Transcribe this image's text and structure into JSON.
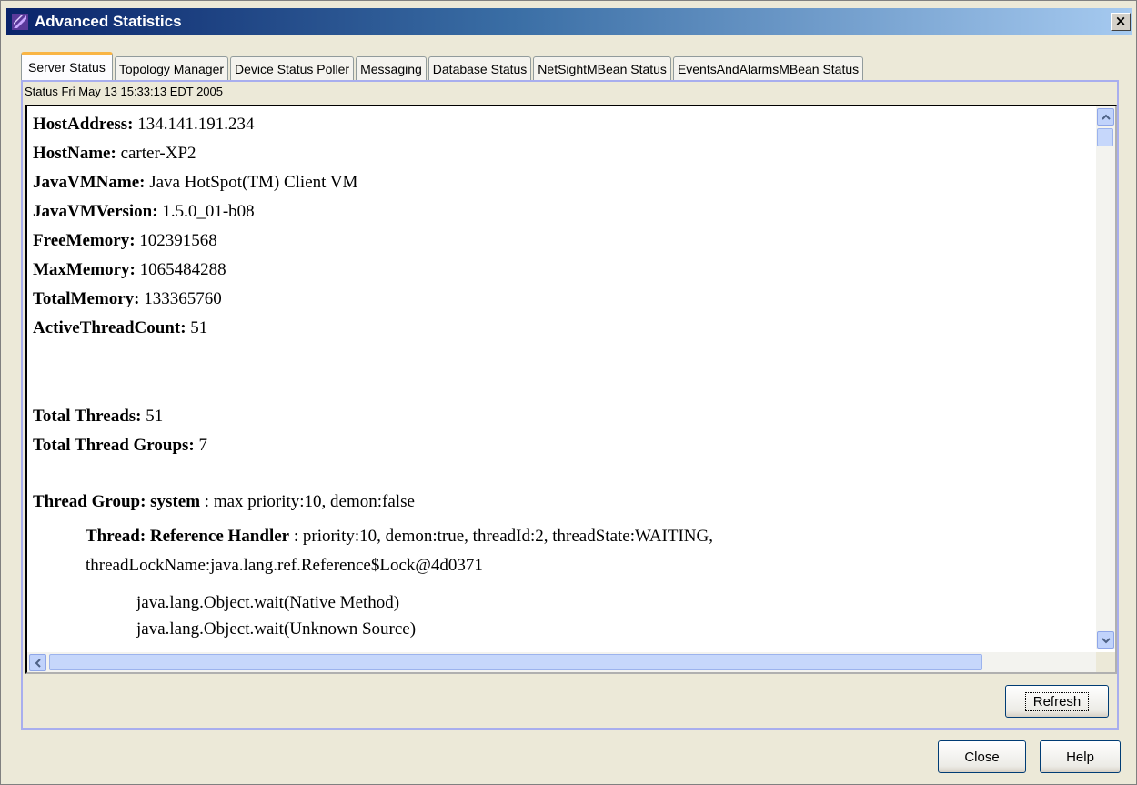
{
  "window": {
    "title": "Advanced Statistics",
    "close_glyph": "×"
  },
  "tabs": [
    {
      "label": "Server Status",
      "active": true
    },
    {
      "label": "Topology Manager",
      "active": false
    },
    {
      "label": "Device Status Poller",
      "active": false
    },
    {
      "label": "Messaging",
      "active": false
    },
    {
      "label": "Database Status",
      "active": false
    },
    {
      "label": "NetSightMBean Status",
      "active": false
    },
    {
      "label": "EventsAndAlarmsMBean Status",
      "active": false
    }
  ],
  "status": "Status Fri May 13 15:33:13 EDT 2005",
  "properties": [
    {
      "key": "HostAddress:",
      "value": " 134.141.191.234"
    },
    {
      "key": "HostName:",
      "value": " carter-XP2"
    },
    {
      "key": "JavaVMName:",
      "value": " Java HotSpot(TM) Client VM"
    },
    {
      "key": "JavaVMVersion:",
      "value": " 1.5.0_01-b08"
    },
    {
      "key": "FreeMemory:",
      "value": " 102391568"
    },
    {
      "key": "MaxMemory:",
      "value": " 1065484288"
    },
    {
      "key": "TotalMemory:",
      "value": " 133365760"
    },
    {
      "key": "ActiveThreadCount:",
      "value": " 51"
    }
  ],
  "totals": [
    {
      "key": "Total Threads:",
      "value": " 51"
    },
    {
      "key": "Total Thread Groups:",
      "value": " 7"
    }
  ],
  "thread_group": {
    "key": "Thread Group: system",
    "value": " : max priority:10, demon:false"
  },
  "thread": {
    "key": "Thread: Reference Handler",
    "value": " : priority:10, demon:true, threadId:2, threadState:WAITING,",
    "lock_line": "threadLockName:java.lang.ref.Reference$Lock@4d0371"
  },
  "stack": [
    "java.lang.Object.wait(Native Method)",
    "java.lang.Object.wait(Unknown Source)"
  ],
  "buttons": {
    "refresh": "Refresh",
    "close": "Close",
    "help": "Help"
  },
  "colors": {
    "title_bar_start": "#0a246a",
    "active_tab_accent": "#f9b545",
    "panel_border": "#a8aeee"
  }
}
